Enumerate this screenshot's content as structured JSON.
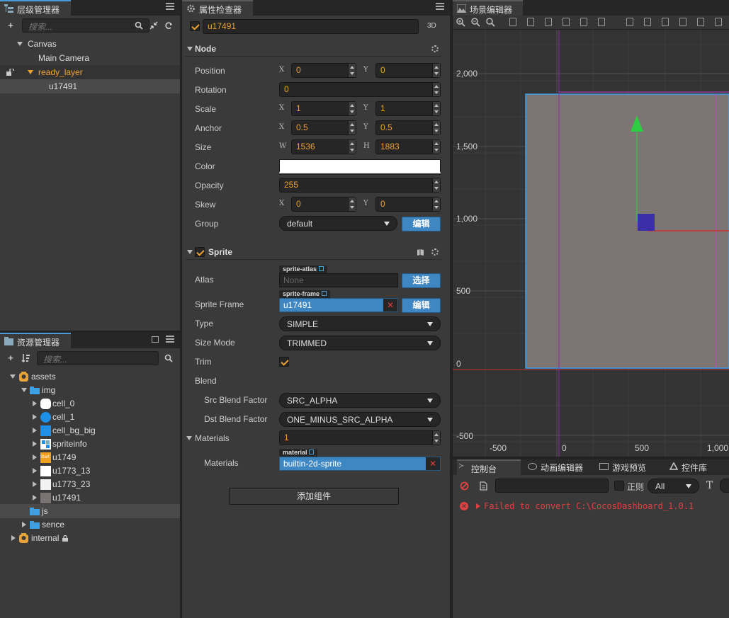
{
  "hierarchy": {
    "tab_label": "层级管理器",
    "search_placeholder": "搜索...",
    "nodes": [
      {
        "label": "Canvas"
      },
      {
        "label": "Main Camera"
      },
      {
        "label": "ready_layer"
      },
      {
        "label": "u17491"
      }
    ]
  },
  "assets": {
    "tab_label": "资源管理器",
    "search_placeholder": "搜索...",
    "nodes": [
      {
        "label": "assets"
      },
      {
        "label": "img"
      },
      {
        "label": "cell_0"
      },
      {
        "label": "cell_1"
      },
      {
        "label": "cell_bg_big"
      },
      {
        "label": "spriteinfo"
      },
      {
        "label": "u1749"
      },
      {
        "label": "u1773_13"
      },
      {
        "label": "u1773_23"
      },
      {
        "label": "u17491"
      },
      {
        "label": "js"
      },
      {
        "label": "sence"
      },
      {
        "label": "internal"
      }
    ],
    "thumb_text_u1749": "Start"
  },
  "inspector": {
    "tab_label": "属性检查器",
    "node_name": "u17491",
    "mode_3d": "3D",
    "node_section": "Node",
    "labels": {
      "position": "Position",
      "rotation": "Rotation",
      "scale": "Scale",
      "anchor": "Anchor",
      "size": "Size",
      "color": "Color",
      "opacity": "Opacity",
      "skew": "Skew",
      "group": "Group"
    },
    "axes": {
      "x": "X",
      "y": "Y",
      "w": "W",
      "h": "H"
    },
    "values": {
      "pos_x": "0",
      "pos_y": "0",
      "rotation": "0",
      "scale_x": "1",
      "scale_y": "1",
      "anchor_x": "0.5",
      "anchor_y": "0.5",
      "size_w": "1536",
      "size_h": "1883",
      "opacity": "255",
      "skew_x": "0",
      "skew_y": "0",
      "group": "default"
    },
    "edit_label": "编辑",
    "select_label": "选择",
    "sprite_section": "Sprite",
    "sprite_labels": {
      "atlas": "Atlas",
      "sprite_frame": "Sprite Frame",
      "type": "Type",
      "size_mode": "Size Mode",
      "trim": "Trim",
      "blend": "Blend",
      "src_blend": "Src Blend Factor",
      "dst_blend": "Dst Blend Factor",
      "materials": "Materials",
      "materials_item": "Materials"
    },
    "sprite_values": {
      "atlas_tag": "sprite-atlas",
      "atlas_value": "None",
      "frame_tag": "sprite-frame",
      "frame_value": "u17491",
      "type": "SIMPLE",
      "size_mode": "TRIMMED",
      "src_blend": "SRC_ALPHA",
      "dst_blend": "ONE_MINUS_SRC_ALPHA",
      "materials_count": "1",
      "material_tag": "material",
      "material_value": "builtin-2d-sprite"
    },
    "add_component": "添加组件"
  },
  "scene": {
    "tab_label": "场景编辑器",
    "y_labels": [
      "2,000",
      "1,500",
      "1,000",
      "500",
      "0",
      "-500"
    ],
    "x_labels": [
      "-500",
      "0",
      "500",
      "1,000"
    ]
  },
  "console": {
    "tabs": [
      "控制台",
      "动画编辑器",
      "游戏预览",
      "控件库"
    ],
    "regex_label": "正则",
    "filter_value": "All",
    "error_text": "Failed to convert C:\\CocosDashboard_1.0.1"
  }
}
